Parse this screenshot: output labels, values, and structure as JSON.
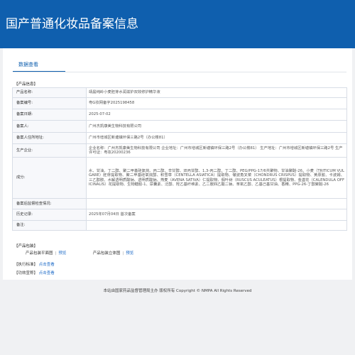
{
  "site": {
    "title": "国产普通化妆品备案信息"
  },
  "tabs": [
    {
      "label": "数据查看"
    }
  ],
  "product_info": {
    "section_title": "【产品信息】",
    "rows": [
      {
        "label": "产品名称:",
        "value": "靖晨纯岭小麦胚芽水润滋护双效修护精华液"
      },
      {
        "label": "备案编号:",
        "value": "粤G妆网备字2025198458"
      },
      {
        "label": "备案日期:",
        "value": "2025-07-02"
      },
      {
        "label": "备案人:",
        "value": "广州杰凯康美生物科技有限公司"
      },
      {
        "label": "备案人住所地址:",
        "value": "广州市增城区新塘镇环保三路2号（办公楼81）"
      },
      {
        "label": "生产企业:",
        "value": "企业名称：广州杰凯康美生物科技有限公司 企业地址：广州市增城区新塘镇环保三路2号（办公楼81） 生产地址：广州市增城区新塘镇环保三路2号 生产许可证：粤妆20200236"
      },
      {
        "label": "成分:",
        "value": "水、甘油、丁二醇、聚二甲基硅氧烷、丙二醇、辛甘醇、双丙甘醇、1,3-丙二醇、丁二醇、PEG/PPG-17/6共聚物、甘油聚醚-26、小麦（TRITICUM VULGARE）胚芽提取物、聚二甲基硅氧烷醇、积雪草（CENTELLA ASIATICA）提取物、皱波角叉菜（CHONDRUS CRISPUS）提取物、黄原胶、卡波姆、三乙醇胺、水解透明质酸钠、透明质酸钠、燕麦（AVENA SATIVA）仁提取物、假叶树（RUSCUS ACULEATUS）根提取物、金盏花（CALENDULA OFFICINALIS）花提取物、生物糖胶-1、尿囊素、泛醇、羟乙基纤维素、乙二胺四乙酸二钠、苯氧乙醇、乙基己基甘油、香精、PPG-26-丁醇聚醚-26"
      },
      {
        "label": "备案后监督检查情况:",
        "value": ""
      },
      {
        "label": "历史记录:",
        "value": "2025年07月04日 首次备案"
      },
      {
        "label": "备注:",
        "value": ""
      }
    ]
  },
  "package": {
    "section_title": "【产品包装】",
    "items": [
      {
        "label": "产品包装平面图",
        "link": "预览"
      },
      {
        "label": "产品包装立体图",
        "link": "预览"
      }
    ]
  },
  "standard": {
    "section_title": "【执行标准】",
    "link": "点击查看"
  },
  "efficacy": {
    "section_title": "【功效宣称】",
    "link": "点击查看"
  },
  "footer": {
    "text": "本站由国家药品监督管理局主办 版权所有 Copyright © NMPA All Rights Reserved"
  }
}
